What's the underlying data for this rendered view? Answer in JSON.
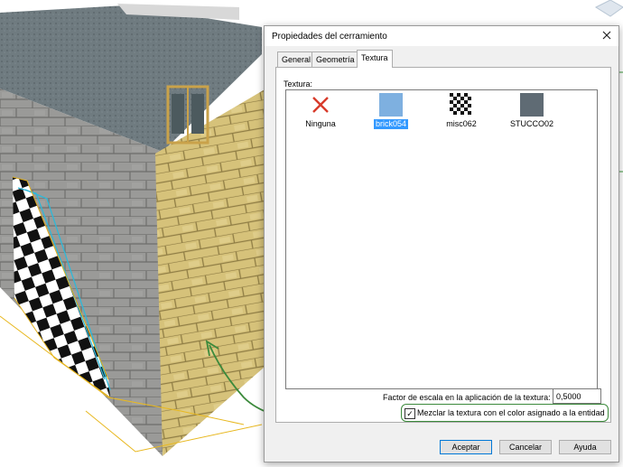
{
  "dialog": {
    "title": "Propiedades del cerramiento",
    "tabs": [
      {
        "label": "General"
      },
      {
        "label": "Geometría"
      },
      {
        "label": "Textura"
      }
    ],
    "texture_label": "Textura:",
    "textures": [
      {
        "name": "Ninguna",
        "icon": "none-x-icon"
      },
      {
        "name": "brick054",
        "icon": "blue-texture-swatch",
        "color": "#7eb0e0"
      },
      {
        "name": "misc062",
        "icon": "checker-texture-swatch"
      },
      {
        "name": "STUCCO02",
        "icon": "gray-texture-swatch",
        "color": "#5f6b74"
      }
    ],
    "selected_texture": "brick054",
    "scale_label": "Factor de escala en la aplicación de la textura:",
    "scale_value": "0,5000",
    "mix_label": "Mezclar la textura con el color asignado a la entidad",
    "mix_checked": "✓",
    "buttons": {
      "ok": "Aceptar",
      "cancel": "Cancelar",
      "help": "Ayuda"
    }
  },
  "colors": {
    "accent_highlight": "#3c8a3c",
    "selection": "#3399ff",
    "close_x": "#d83b2b"
  }
}
